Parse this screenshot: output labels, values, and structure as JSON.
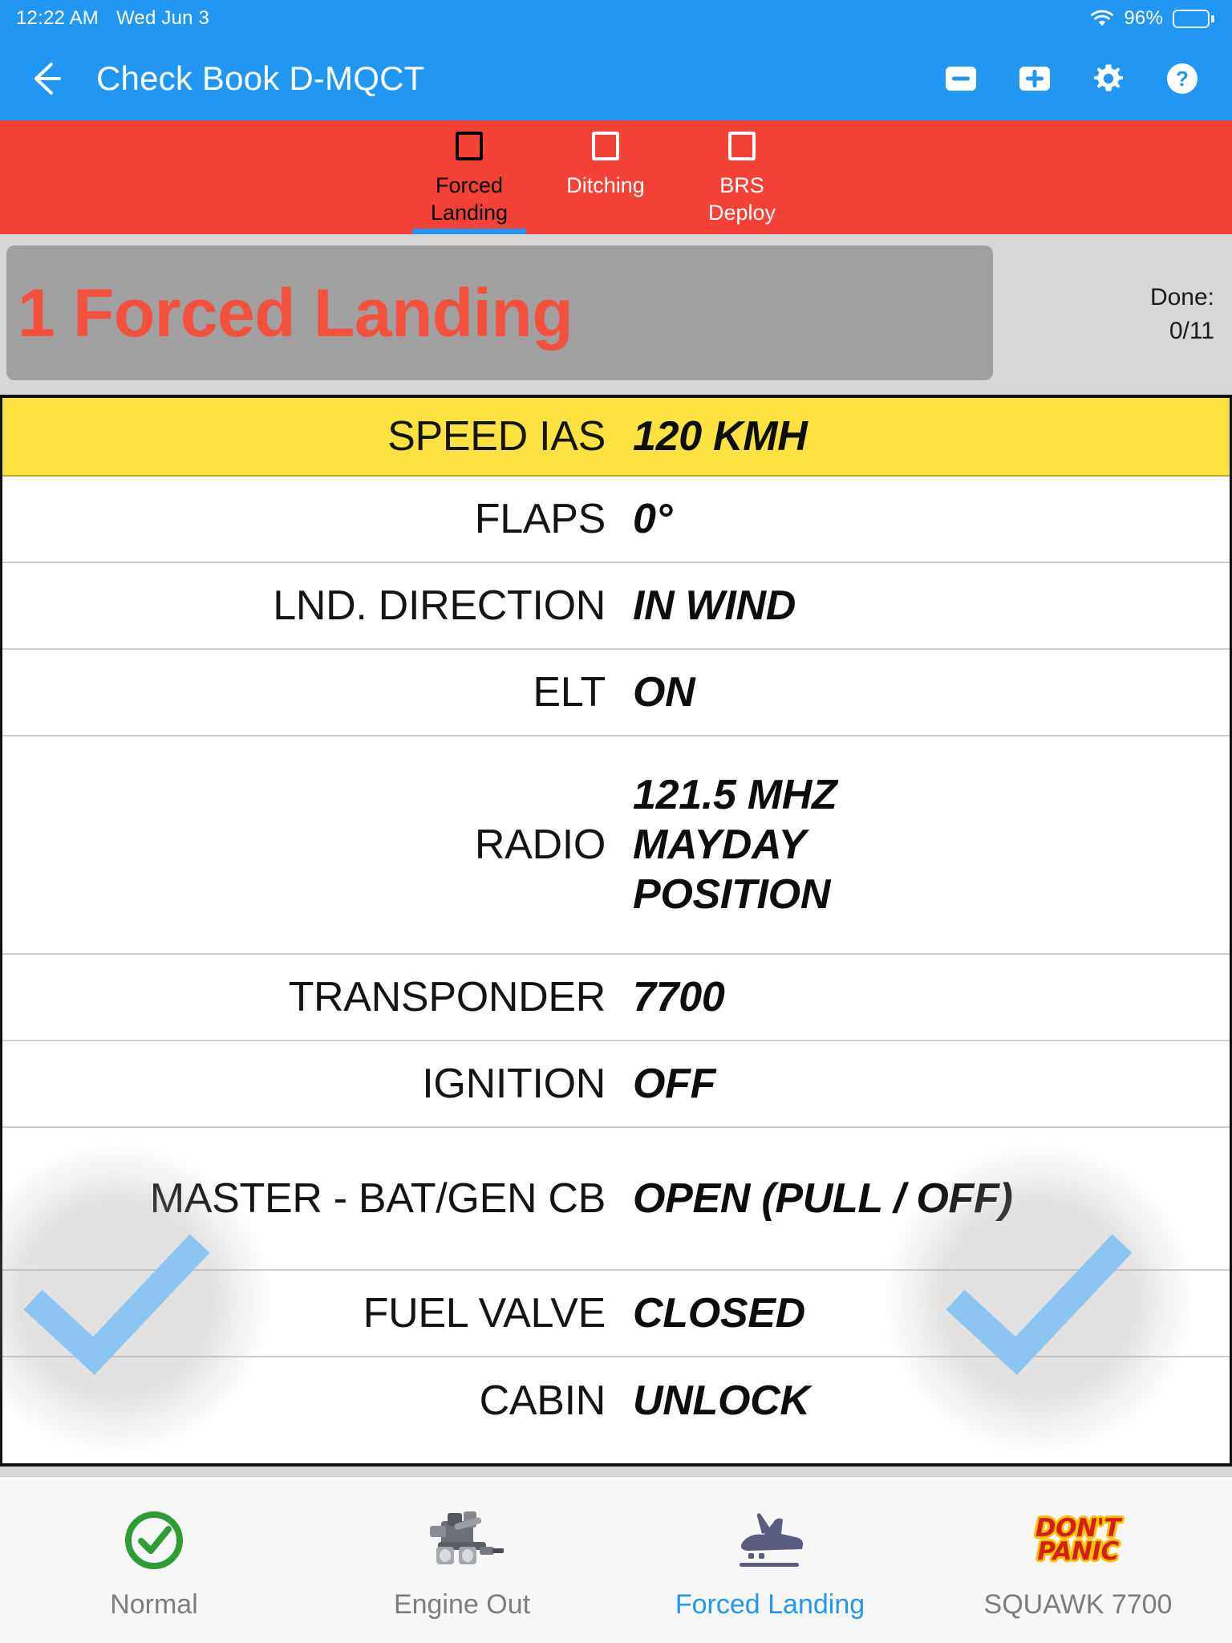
{
  "statusbar": {
    "time": "12:22 AM",
    "date": "Wed Jun 3",
    "battery_percent": "96%",
    "wifi_icon": "wifi-icon",
    "battery_icon": "battery-icon"
  },
  "appbar": {
    "back_icon": "back-arrow-icon",
    "title": "Check Book D-MQCT",
    "actions": [
      {
        "name": "minus-box-icon",
        "label": "−"
      },
      {
        "name": "plus-box-icon",
        "label": "+"
      },
      {
        "name": "gear-icon",
        "label": ""
      },
      {
        "name": "help-icon",
        "label": "?"
      }
    ]
  },
  "tabs": [
    {
      "label": "Forced\nLanding",
      "line1": "Forced",
      "line2": "Landing",
      "active": true,
      "checked": false
    },
    {
      "label": "Ditching",
      "line1": "Ditching",
      "line2": "",
      "active": false,
      "checked": false
    },
    {
      "label": "BRS Deploy",
      "line1": "BRS",
      "line2": "Deploy",
      "active": false,
      "checked": false
    }
  ],
  "section": {
    "title": "1 Forced Landing",
    "done_label": "Done:",
    "done_value": "0/11",
    "accent_color": "#F4503C",
    "banner_color": "#A0A0A0"
  },
  "checklist": {
    "rows": [
      {
        "label": "SPEED IAS",
        "value": "120 KMH",
        "highlight": true
      },
      {
        "label": "FLAPS",
        "value": "0°",
        "highlight": false
      },
      {
        "label": "LND. DIRECTION",
        "value": "IN WIND",
        "highlight": false
      },
      {
        "label": "ELT",
        "value": "ON",
        "highlight": false
      },
      {
        "label": "RADIO",
        "value": "121.5 MHZ\nMAYDAY\nPOSITION",
        "value_lines": [
          "121.5 MHZ",
          "MAYDAY",
          "POSITION"
        ],
        "highlight": false
      },
      {
        "label": "TRANSPONDER",
        "value": "7700",
        "highlight": false
      },
      {
        "label": "IGNITION",
        "value": "OFF",
        "highlight": false
      },
      {
        "label": "MASTER - BAT/GEN CB",
        "label_lines": [
          "MASTER - BAT/GEN",
          "CB"
        ],
        "value": "OPEN (PULL / OFF)",
        "highlight": false
      },
      {
        "label": "FUEL VALVE",
        "value": "CLOSED",
        "highlight": false
      },
      {
        "label": "CABIN",
        "value": "UNLOCK",
        "highlight": false
      }
    ],
    "highlight_color": "#FBE241"
  },
  "swipe_hints": {
    "left_icon": "check-swipe-hint-icon",
    "right_icon": "check-swipe-hint-icon",
    "check_color": "#8CC5F0"
  },
  "bottomnav": [
    {
      "label": "Normal",
      "icon": "green-check-circle-icon",
      "active": false
    },
    {
      "label": "Engine Out",
      "icon": "engine-icon",
      "active": false
    },
    {
      "label": "Forced Landing",
      "icon": "plane-landing-icon",
      "active": true
    },
    {
      "label": "SQUAWK 7700",
      "icon": "dont-panic-icon",
      "logo_line1": "DON'T",
      "logo_line2": "PANIC",
      "active": false
    }
  ],
  "colors": {
    "header_blue": "#2196F3",
    "alert_red": "#F44336",
    "section_grey": "#D7D7D7",
    "banner_grey": "#A0A0A0"
  }
}
